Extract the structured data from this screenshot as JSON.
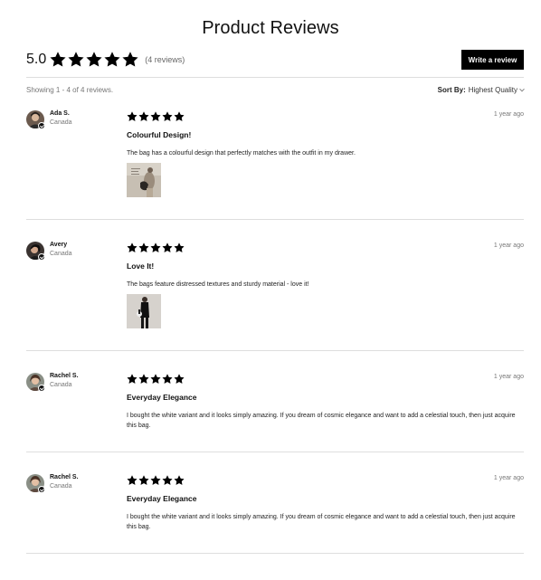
{
  "page": {
    "title": "Product Reviews"
  },
  "summary": {
    "score": "5.0",
    "rating": 5,
    "max_rating": 5,
    "count_label": "(4 reviews)",
    "write_review_label": "Write a review"
  },
  "toolbar": {
    "showing": "Showing 1 - 4 of 4 reviews.",
    "sort_label": "Sort By:",
    "sort_value": "Highest Quality"
  },
  "colors": {
    "star": "#000000",
    "button": "#000000",
    "divider": "#dedede"
  },
  "reviews": [
    {
      "name": "Ada S.",
      "location": "Canada",
      "rating": 5,
      "date": "1 year ago",
      "title": "Colourful Design!",
      "text": "The bag has a colourful design that perfectly matches with the outfit in my drawer.",
      "has_photo": true,
      "photo_alt": "customer photo"
    },
    {
      "name": "Avery",
      "location": "Canada",
      "rating": 5,
      "date": "1 year ago",
      "title": "Love It!",
      "text": "The bags feature distressed textures and sturdy material - love it!",
      "has_photo": true,
      "photo_alt": "customer photo"
    },
    {
      "name": "Rachel S.",
      "location": "Canada",
      "rating": 5,
      "date": "1 year ago",
      "title": "Everyday Elegance",
      "text": "I bought the white variant and it looks simply amazing. If you dream of cosmic elegance and want to add a celestial touch, then just acquire this bag.",
      "has_photo": false
    },
    {
      "name": "Rachel S.",
      "location": "Canada",
      "rating": 5,
      "date": "1 year ago",
      "title": "Everyday Elegance",
      "text": "I bought the white variant and it looks simply amazing. If you dream of cosmic elegance and want to add a celestial touch, then just acquire this bag.",
      "has_photo": false
    }
  ]
}
